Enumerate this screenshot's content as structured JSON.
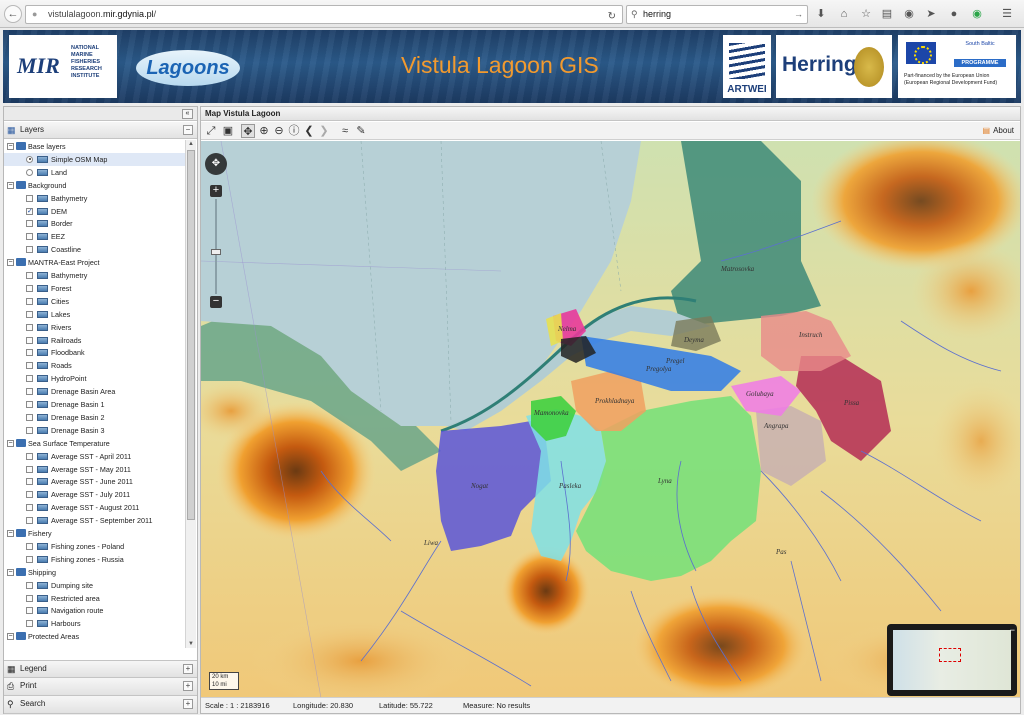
{
  "browser": {
    "url_prefix": "vistulalagoon.",
    "url_host": "mir.gdynia.pl",
    "url_suffix": "/",
    "search_value": "herring"
  },
  "header": {
    "title": "Vistula Lagoon GIS",
    "mir_logo": "MIR",
    "mir_sub": "NATIONAL MARINE FISHERIES RESEARCH INSTITUTE",
    "lagoons_logo": "Lagoons",
    "artwei_logo": "ARTWEI",
    "herring_logo": "Herring",
    "eu_program": "South Baltic",
    "eu_program_sub": "PROGRAMME",
    "eu_text": "Part-financed by the European Union (European Regional Development Fund)"
  },
  "left_panel": {
    "layers_label": "Layers",
    "legend_label": "Legend",
    "print_label": "Print",
    "search_label": "Search",
    "tree": [
      {
        "type": "group",
        "label": "Base layers"
      },
      {
        "type": "radio",
        "label": "Simple OSM Map",
        "checked": true,
        "selected": true
      },
      {
        "type": "radio",
        "label": "Land",
        "checked": false
      },
      {
        "type": "group",
        "label": "Background"
      },
      {
        "type": "check",
        "label": "Bathymetry",
        "checked": false
      },
      {
        "type": "check",
        "label": "DEM",
        "checked": true
      },
      {
        "type": "check",
        "label": "Border",
        "checked": false
      },
      {
        "type": "check",
        "label": "EEZ",
        "checked": false
      },
      {
        "type": "check",
        "label": "Coastline",
        "checked": false
      },
      {
        "type": "group",
        "label": "MANTRA-East Project"
      },
      {
        "type": "check",
        "label": "Bathymetry",
        "checked": false
      },
      {
        "type": "check",
        "label": "Forest",
        "checked": false
      },
      {
        "type": "check",
        "label": "Cities",
        "checked": false
      },
      {
        "type": "check",
        "label": "Lakes",
        "checked": false
      },
      {
        "type": "check",
        "label": "Rivers",
        "checked": false
      },
      {
        "type": "check",
        "label": "Railroads",
        "checked": false
      },
      {
        "type": "check",
        "label": "Floodbank",
        "checked": false
      },
      {
        "type": "check",
        "label": "Roads",
        "checked": false
      },
      {
        "type": "check",
        "label": "HydroPoint",
        "checked": false
      },
      {
        "type": "check",
        "label": "Drenage Basin Area",
        "checked": false
      },
      {
        "type": "check",
        "label": "Drenage Basin 1",
        "checked": false
      },
      {
        "type": "check",
        "label": "Drenage Basin 2",
        "checked": false
      },
      {
        "type": "check",
        "label": "Drenage Basin 3",
        "checked": false
      },
      {
        "type": "group",
        "label": "Sea Surface Temperature"
      },
      {
        "type": "check",
        "label": "Average SST - April 2011",
        "checked": false
      },
      {
        "type": "check",
        "label": "Average SST - May 2011",
        "checked": false
      },
      {
        "type": "check",
        "label": "Average SST - June 2011",
        "checked": false
      },
      {
        "type": "check",
        "label": "Average SST - July 2011",
        "checked": false
      },
      {
        "type": "check",
        "label": "Average SST - August 2011",
        "checked": false
      },
      {
        "type": "check",
        "label": "Average SST - September 2011",
        "checked": false
      },
      {
        "type": "group",
        "label": "Fishery"
      },
      {
        "type": "check",
        "label": "Fishing zones - Poland",
        "checked": false
      },
      {
        "type": "check",
        "label": "Fishing zones - Russia",
        "checked": false
      },
      {
        "type": "group",
        "label": "Shipping"
      },
      {
        "type": "check",
        "label": "Dumping site",
        "checked": false
      },
      {
        "type": "check",
        "label": "Restricted area",
        "checked": false
      },
      {
        "type": "check",
        "label": "Navigation route",
        "checked": false
      },
      {
        "type": "check",
        "label": "Harbours",
        "checked": false
      },
      {
        "type": "group",
        "label": "Protected Areas"
      }
    ]
  },
  "map_panel": {
    "title": "Map Vistula Lagoon",
    "about_label": "About",
    "scale_label": "Scale : 1 : 2183916",
    "longitude_label": "Longitude: 20.830",
    "latitude_label": "Latitude: 55.722",
    "measure_label": "Measure: No results",
    "scale_km": "20 km",
    "scale_mi": "10 mi",
    "basin_labels": [
      "Nelma",
      "Deyma",
      "Pregel",
      "Pregolya",
      "Instruch",
      "Prokhladnaya",
      "Mamonovka",
      "Golubaya",
      "Pissa",
      "Angrapa",
      "Nogat",
      "Pasleka",
      "Lyna",
      "Liwa",
      "Matrosovka",
      "Pas"
    ],
    "colors": {
      "sea": "#b7d0d6",
      "lagoon": "#b3cdd2",
      "accent": "#f29a2e",
      "banner": "#1f4068"
    }
  }
}
